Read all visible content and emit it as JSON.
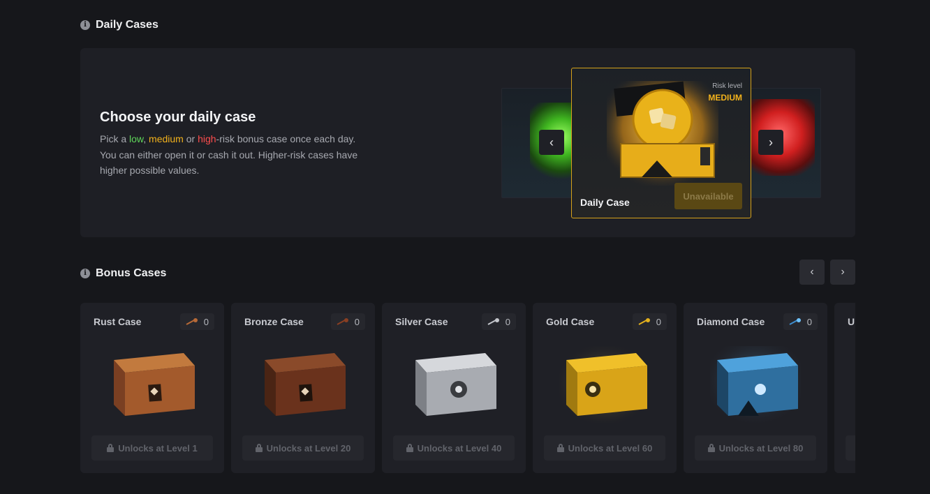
{
  "daily": {
    "section_title": "Daily Cases",
    "heading": "Choose your daily case",
    "desc_pick": "Pick a ",
    "low": "low",
    "comma": ", ",
    "medium": "medium",
    "or": " or ",
    "high": "high",
    "desc_rest": "-risk bonus case once each day. You can either open it or cash it out. Higher-risk cases have higher possible values.",
    "card": {
      "risk_label": "Risk level",
      "risk_value": "MEDIUM",
      "name": "Daily Case",
      "button": "Unavailable"
    },
    "prev_icon": "chevron-left-icon",
    "next_icon": "chevron-right-icon"
  },
  "bonus": {
    "section_title": "Bonus Cases",
    "cases": [
      {
        "name": "Rust Case",
        "keys": "0",
        "unlock": "Unlocks at Level 1",
        "color": "#b86a37"
      },
      {
        "name": "Bronze Case",
        "keys": "0",
        "unlock": "Unlocks at Level 20",
        "color": "#7a3f22"
      },
      {
        "name": "Silver Case",
        "keys": "0",
        "unlock": "Unlocks at Level 40",
        "color": "#b9bcc2"
      },
      {
        "name": "Gold Case",
        "keys": "0",
        "unlock": "Unlocks at Level 60",
        "color": "#e4b11d"
      },
      {
        "name": "Diamond Case",
        "keys": "0",
        "unlock": "Unlocks at Level 80",
        "color": "#3f8fcf"
      },
      {
        "name": "U",
        "keys": "",
        "unlock": "",
        "color": "#555"
      }
    ]
  },
  "colors": {
    "accent_gold": "#f2b21c",
    "low_green": "#5fd65a",
    "high_red": "#ff4d4d"
  }
}
